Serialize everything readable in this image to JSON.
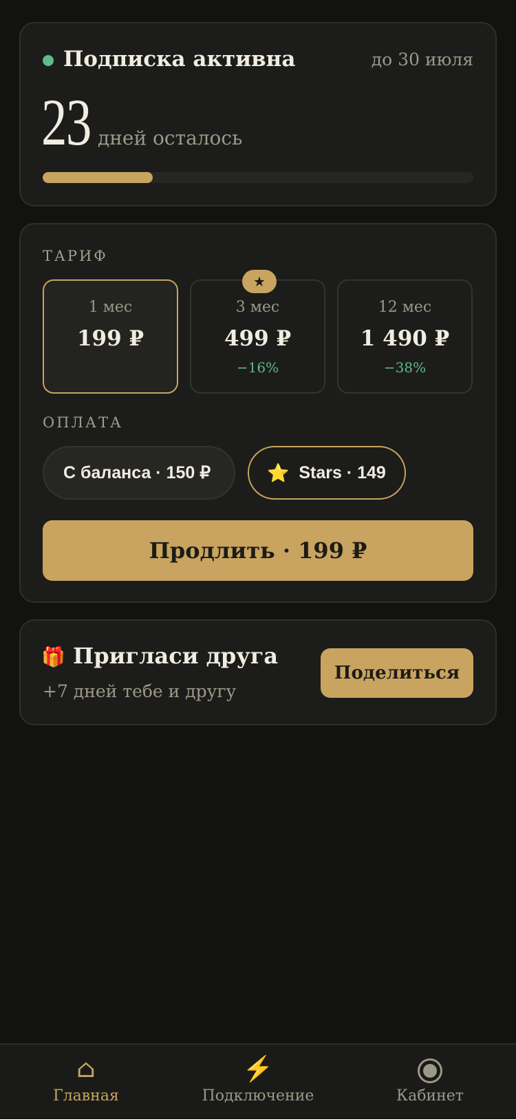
{
  "status": {
    "title": "Подписка активна",
    "until": "до 30 июля",
    "days_left": "23",
    "days_label": "дней осталось",
    "progress_fraction": 0.255,
    "accent_color": "#c8a460",
    "active_color": "#5ebb8c"
  },
  "tariff": {
    "label": "ТАРИФ",
    "plans": [
      {
        "period": "1 мес",
        "price": "199 ₽",
        "discount": "",
        "selected": true,
        "badge": ""
      },
      {
        "period": "3 мес",
        "price": "499 ₽",
        "discount": "−16%",
        "selected": false,
        "badge": "★"
      },
      {
        "period": "12 мес",
        "price": "1 490 ₽",
        "discount": "−38%",
        "selected": false,
        "badge": ""
      }
    ]
  },
  "payment": {
    "label": "ОПЛАТА",
    "balance_label": "С баланса · 150 ₽",
    "stars_icon": "⭐",
    "stars_label": "Stars · 149"
  },
  "renew_button": "Продлить · 199 ₽",
  "invite": {
    "icon": "🎁",
    "title": "Пригласи друга",
    "subtitle": "+7 дней тебе и другу",
    "share_label": "Поделиться"
  },
  "nav": [
    {
      "icon": "home-icon",
      "label": "Главная",
      "active": true
    },
    {
      "icon": "bolt-icon",
      "label": "Подключение",
      "active": false
    },
    {
      "icon": "user-circle-icon",
      "label": "Кабинет",
      "active": false
    }
  ]
}
